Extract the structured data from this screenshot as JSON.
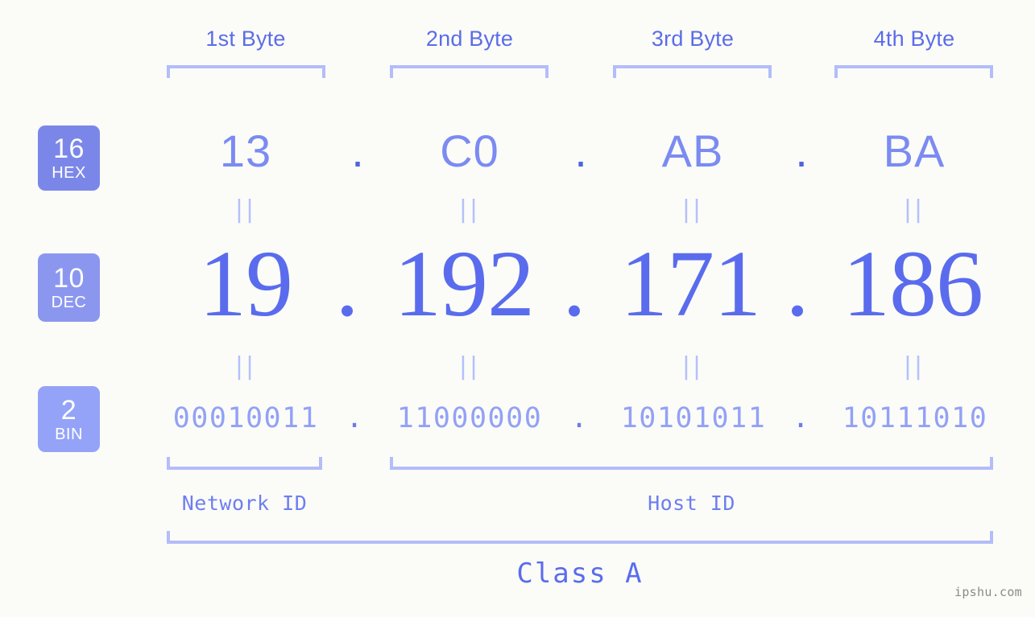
{
  "background_color": "#fbfcf8",
  "accent_colors": {
    "bracket": "#b3bdfa",
    "hex_text": "#7b8bf2",
    "dec_text": "#5a6ced",
    "bin_text": "#93a1f5",
    "header_text": "#5b6ce8",
    "badge_hex": "#7b87e8",
    "badge_dec": "#8b97ef",
    "badge_bin": "#94a3f7",
    "equals_mark": "#b6c0fb",
    "watermark": "#8a8a8a"
  },
  "byte_headers": [
    {
      "label": "1st Byte"
    },
    {
      "label": "2nd Byte"
    },
    {
      "label": "3rd Byte"
    },
    {
      "label": "4th Byte"
    }
  ],
  "radix_badges": [
    {
      "base": "16",
      "name": "HEX"
    },
    {
      "base": "10",
      "name": "DEC"
    },
    {
      "base": "2",
      "name": "BIN"
    }
  ],
  "separator": ".",
  "equals_mark": "||",
  "rows": {
    "hex": {
      "base": 16,
      "label": "HEX",
      "values": [
        "13",
        "C0",
        "AB",
        "BA"
      ]
    },
    "dec": {
      "base": 10,
      "label": "DEC",
      "values": [
        "19",
        "192",
        "171",
        "186"
      ]
    },
    "bin": {
      "base": 2,
      "label": "BIN",
      "values": [
        "00010011",
        "11000000",
        "10101011",
        "10111010"
      ]
    }
  },
  "ip_address": {
    "hex": "13.C0.AB.BA",
    "dec": "19.192.171.186",
    "bin": "00010011.11000000.10101011.10111010"
  },
  "segments": [
    {
      "label": "Network ID"
    },
    {
      "label": "Host ID"
    }
  ],
  "class": {
    "label": "Class A"
  },
  "watermark": {
    "text": "ipshu.com"
  }
}
